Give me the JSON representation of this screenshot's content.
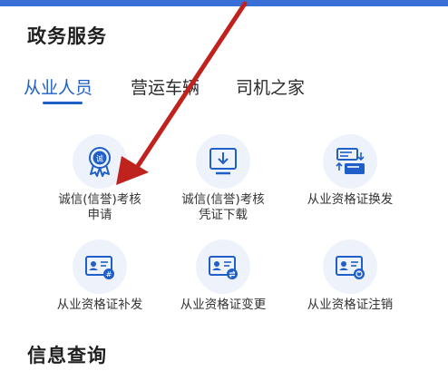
{
  "colors": {
    "accent": "#1f5fc7",
    "topbar": "#3b6fd8",
    "annotation_arrow": "#c0221e"
  },
  "gov_services": {
    "title": "政务服务"
  },
  "tabs": [
    {
      "label": "从业人员",
      "active": true
    },
    {
      "label": "营运车辆",
      "active": false
    },
    {
      "label": "司机之家",
      "active": false
    }
  ],
  "services": [
    {
      "label": "诚信(信誉)考核\n申请",
      "icon": "integrity-badge-icon"
    },
    {
      "label": "诚信(信誉)考核\n凭证下载",
      "icon": "download-icon"
    },
    {
      "label": "从业资格证换发",
      "icon": "card-exchange-icon"
    },
    {
      "label": "从业资格证补发",
      "icon": "id-card-reissue-icon"
    },
    {
      "label": "从业资格证变更",
      "icon": "id-card-change-icon"
    },
    {
      "label": "从业资格证注销",
      "icon": "id-card-cancel-icon"
    }
  ],
  "info_query": {
    "title": "信息查询"
  }
}
